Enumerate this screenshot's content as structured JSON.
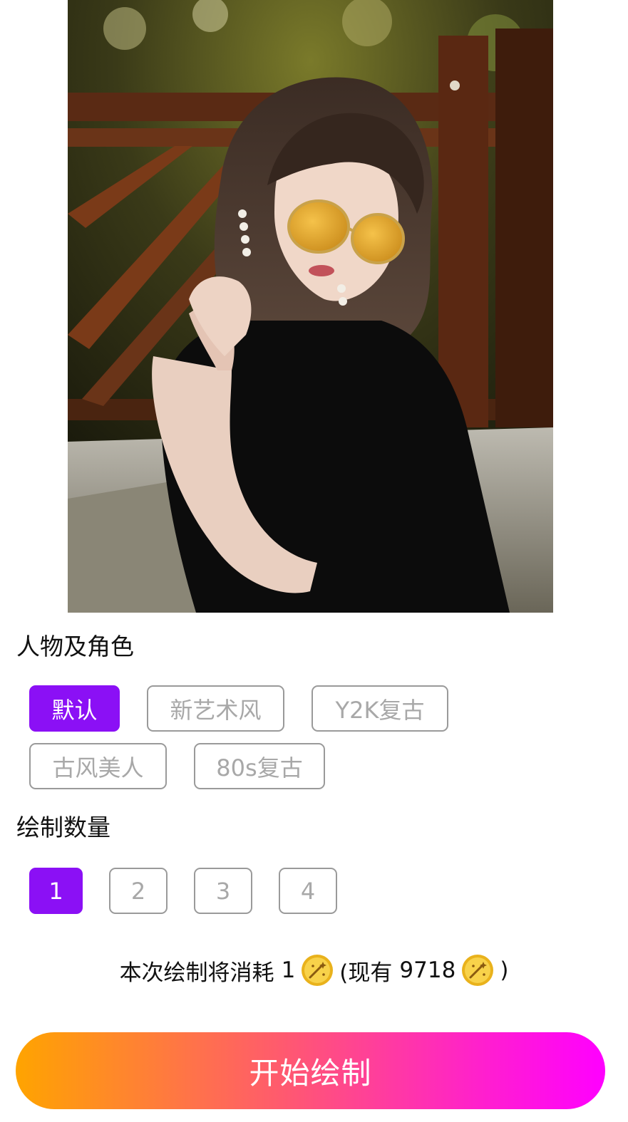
{
  "style_section": {
    "title": "人物及角色",
    "options": [
      {
        "label": "默认",
        "selected": true
      },
      {
        "label": "新艺术风",
        "selected": false
      },
      {
        "label": "Y2K复古",
        "selected": false
      },
      {
        "label": "古风美人",
        "selected": false
      },
      {
        "label": "80s复古",
        "selected": false
      }
    ]
  },
  "count_section": {
    "title": "绘制数量",
    "options": [
      {
        "label": "1",
        "selected": true
      },
      {
        "label": "2",
        "selected": false
      },
      {
        "label": "3",
        "selected": false
      },
      {
        "label": "4",
        "selected": false
      }
    ]
  },
  "cost": {
    "prefix": "本次绘制将消耗",
    "amount": "1",
    "balance_prefix": "(现有",
    "balance": "9718",
    "suffix": ")",
    "coin_icon": "magic-wand-coin-icon"
  },
  "start_button": {
    "label": "开始绘制"
  },
  "colors": {
    "accent": "#8b10f5",
    "gradient_start": "#ffa400",
    "gradient_end": "#ff00ff",
    "coin": "#f2c230"
  }
}
